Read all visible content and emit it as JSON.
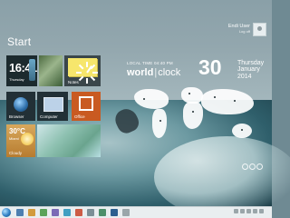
{
  "start": {
    "title": "Start"
  },
  "user": {
    "name": "Endi User",
    "subtitle": "Log off"
  },
  "tiles": {
    "clock": {
      "time": "16:41",
      "weekday": "Thursday"
    },
    "sticky": {
      "label": "Notes"
    },
    "browser": {
      "label": "Browser"
    },
    "computer": {
      "label": "Computer"
    },
    "office": {
      "label": "Office"
    },
    "weather": {
      "temp": "30°C",
      "city": "Miami",
      "label": "Cloudy"
    }
  },
  "world_clock": {
    "local_time_label": "LOCAL TIME 04:40 PM",
    "title_world": "world",
    "title_sep": "|",
    "title_clock": "clock",
    "day": "30",
    "weekday": "Thursday",
    "month": "January",
    "year": "2014"
  },
  "icons": {
    "avatar": "user-avatar-icon",
    "start_orb": "windows-start-icon"
  },
  "colors": {
    "office_tile": "#c95a21",
    "weather_tile": "#d8a85c",
    "taskbar": "#e9eef0"
  }
}
